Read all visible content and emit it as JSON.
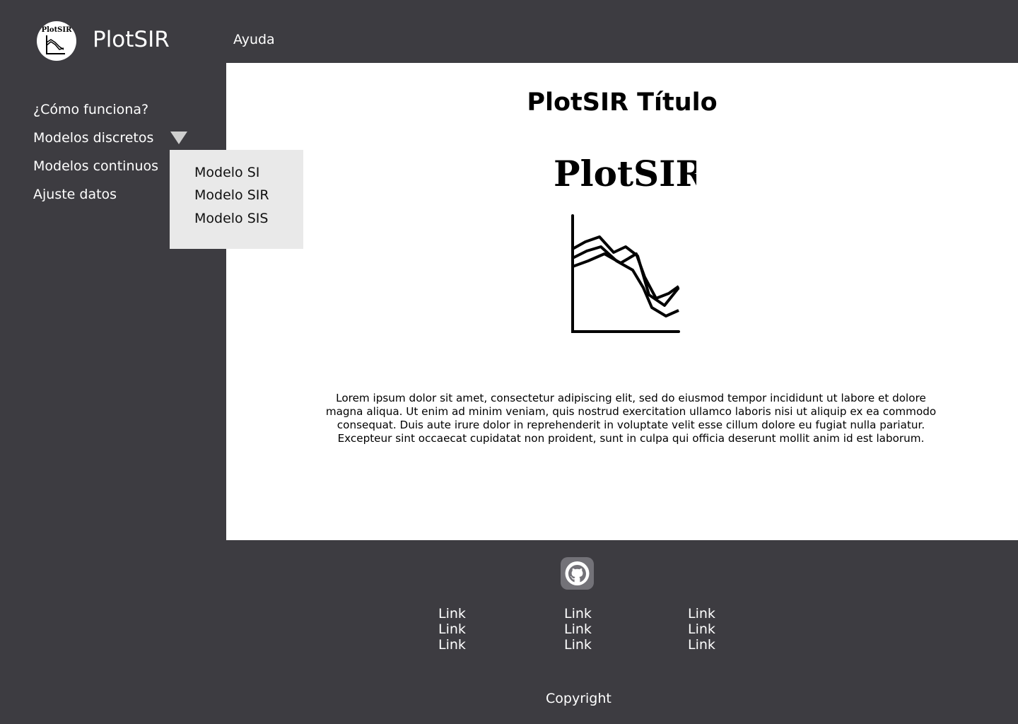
{
  "header": {
    "logo_text": "PlotSIR",
    "app_name": "PlotSIR",
    "help_link": "Ayuda",
    "logo_icon": "plotsir-logo-icon"
  },
  "sidebar": {
    "items": [
      {
        "label": "¿Cómo funciona?"
      },
      {
        "label": "Modelos discretos",
        "expanded": true,
        "icon": "triangle-down-icon"
      },
      {
        "label": "Modelos continuos"
      },
      {
        "label": "Ajuste datos"
      }
    ]
  },
  "dropdown": {
    "items": [
      {
        "label": "Modelo SI"
      },
      {
        "label": "Modelo SIR"
      },
      {
        "label": "Modelo SIS"
      }
    ]
  },
  "main": {
    "title": "PlotSIR Título",
    "wordmark": "PlotSIR",
    "body_text": "Lorem ipsum dolor sit amet, consectetur adipiscing elit, sed do eiusmod tempor incididunt ut labore et dolore magna aliqua. Ut enim ad minim veniam, quis nostrud exercitation ullamco laboris nisi ut aliquip ex ea commodo consequat. Duis aute irure dolor in reprehenderit in voluptate velit esse cillum dolore eu fugiat nulla pariatur. Excepteur sint occaecat cupidatat non proident, sunt in culpa qui officia deserunt mollit anim id est laborum."
  },
  "footer": {
    "github_icon": "github-icon",
    "columns": [
      {
        "links": [
          "Link",
          "Link",
          "Link"
        ]
      },
      {
        "links": [
          "Link",
          "Link",
          "Link"
        ]
      },
      {
        "links": [
          "Link",
          "Link",
          "Link"
        ]
      }
    ],
    "copyright": "Copyright"
  },
  "colors": {
    "background": "#3d3c41",
    "panel": "#ffffff",
    "dropdown": "#e9e9e9",
    "github_button": "#737278",
    "text_light": "#ffffff"
  }
}
